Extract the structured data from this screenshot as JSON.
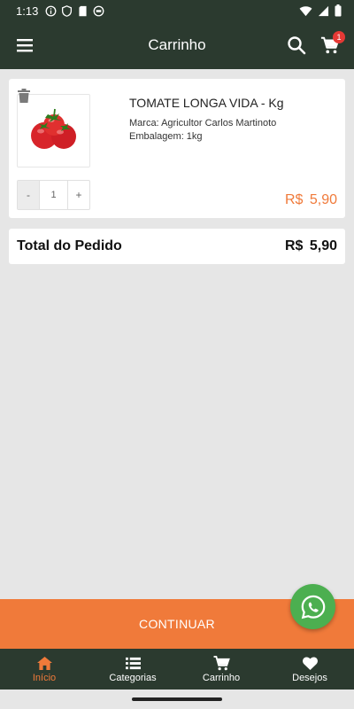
{
  "status_bar": {
    "time": "1:13"
  },
  "app_bar": {
    "title": "Carrinho",
    "cart_badge": "1"
  },
  "cart_item": {
    "name": "TOMATE LONGA VIDA - Kg",
    "brand_line": "Marca: Agricultor Carlos Martinoto",
    "package_line": "Embalagem: 1kg",
    "stepper": {
      "minus": "-",
      "quantity": "1",
      "plus": "+"
    },
    "price": "R$ 5,90"
  },
  "total": {
    "label": "Total do Pedido",
    "value": "R$ 5,90"
  },
  "continue_button": {
    "label": "CONTINUAR"
  },
  "bottom_nav": {
    "items": [
      {
        "label": "Início",
        "icon": "home-icon"
      },
      {
        "label": "Categorias",
        "icon": "list-icon"
      },
      {
        "label": "Carrinho",
        "icon": "cart-icon"
      },
      {
        "label": "Desejos",
        "icon": "heart-icon"
      }
    ]
  },
  "colors": {
    "header": "#2b3a2f",
    "accent": "#f07a3a",
    "whatsapp": "#4caf50",
    "background": "#e6e6e6",
    "badge": "#e53935"
  }
}
